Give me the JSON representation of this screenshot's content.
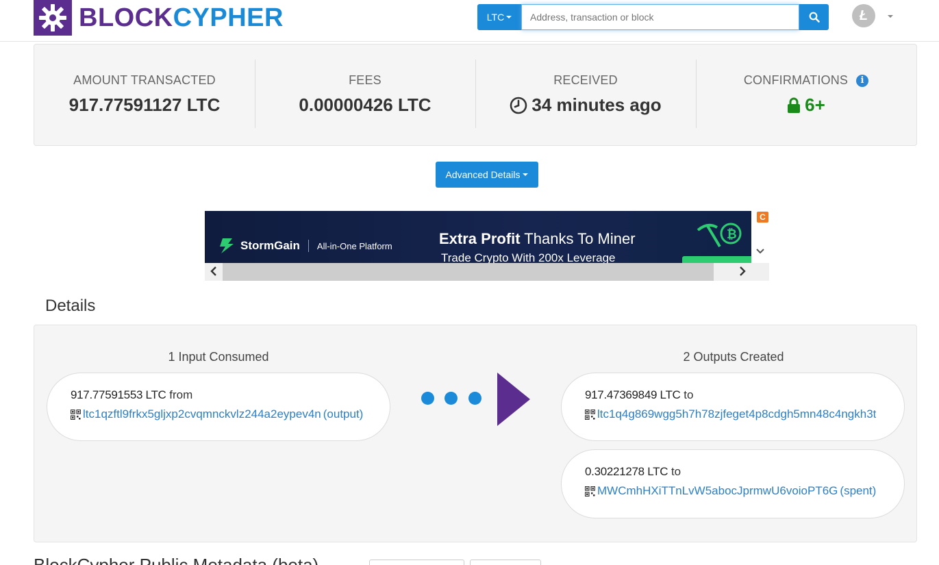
{
  "header": {
    "logo_left": "BLOCK",
    "logo_right": "CYPHER",
    "coin_label": "LTC",
    "search_placeholder": "Address, transaction or block",
    "avatar_letter": "Ł"
  },
  "summary": {
    "amount_label": "AMOUNT TRANSACTED",
    "amount_value": "917.77591127 LTC",
    "fees_label": "FEES",
    "fees_value": "0.00000426 LTC",
    "received_label": "RECEIVED",
    "received_value": "34 minutes ago",
    "confirmations_label": "CONFIRMATIONS",
    "confirmations_value": "6+"
  },
  "advanced_details_label": "Advanced Details",
  "ad": {
    "brand": "StormGain",
    "brand_sub": "All-in-One Platform",
    "headline_bold": "Extra Profit",
    "headline_rest": " Thanks To Miner",
    "subline": "Trade Crypto With 200x Leverage",
    "corner_badge": "C"
  },
  "details": {
    "title": "Details",
    "inputs_title": "1 Input Consumed",
    "outputs_title": "2 Outputs Created",
    "inputs": [
      {
        "amount": "917.77591553 LTC",
        "direction": "from",
        "address": "ltc1qzftl9frkx5gljxp2cvqmnckvlz244a2eypev4n",
        "status": "(output)"
      }
    ],
    "outputs": [
      {
        "amount": "917.47369849 LTC",
        "direction": "to",
        "address": "ltc1q4g869wgg5h7h78zjfeget4p8cdgh5mn48c4ngkh3t",
        "status": ""
      },
      {
        "amount": "0.30221278 LTC",
        "direction": "to",
        "address": "MWCmhHXiTTnLvW5abocJprmwU6voioPT6G",
        "status": "(spent)"
      }
    ]
  },
  "footer_partial": "BlockCypher Public Metadata (beta)",
  "colors": {
    "brand_purple": "#5b2d8e",
    "brand_blue": "#1a8ad6",
    "button_blue": "#1b8ad8",
    "link_blue": "#2a7fc9",
    "confirm_green": "#1a8a1a"
  }
}
